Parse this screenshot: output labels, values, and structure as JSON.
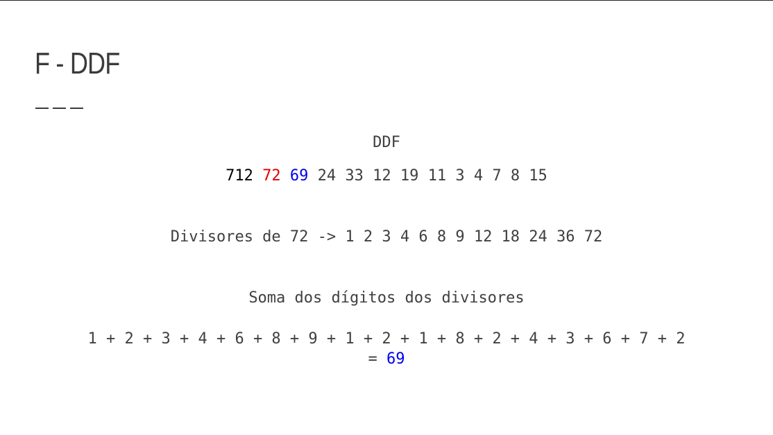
{
  "slide": {
    "title": "F - DDF",
    "heading": "DDF",
    "sequence": {
      "first": "712",
      "highlight_red": "72",
      "highlight_blue": "69",
      "rest": "24 33 12 19 11 3 4 7 8 15"
    },
    "divisors_line": "Divisores de 72 -> 1 2 3 4 6 8 9 12 18 24 36 72",
    "digit_sum_heading": "Soma dos dígitos dos divisores",
    "digit_sum_expression": "1 + 2 + 3 + 4 + 6 + 8 + 9 + 1 + 2 + 1 + 8 + 2 + 4 + 3 + 6 + 7 + 2",
    "result_equals": "=",
    "result_value": "69"
  },
  "colors": {
    "text": "#3f3f3f",
    "first_number": "#000000",
    "highlight_red": "#e00000",
    "highlight_blue": "#0000ee"
  }
}
